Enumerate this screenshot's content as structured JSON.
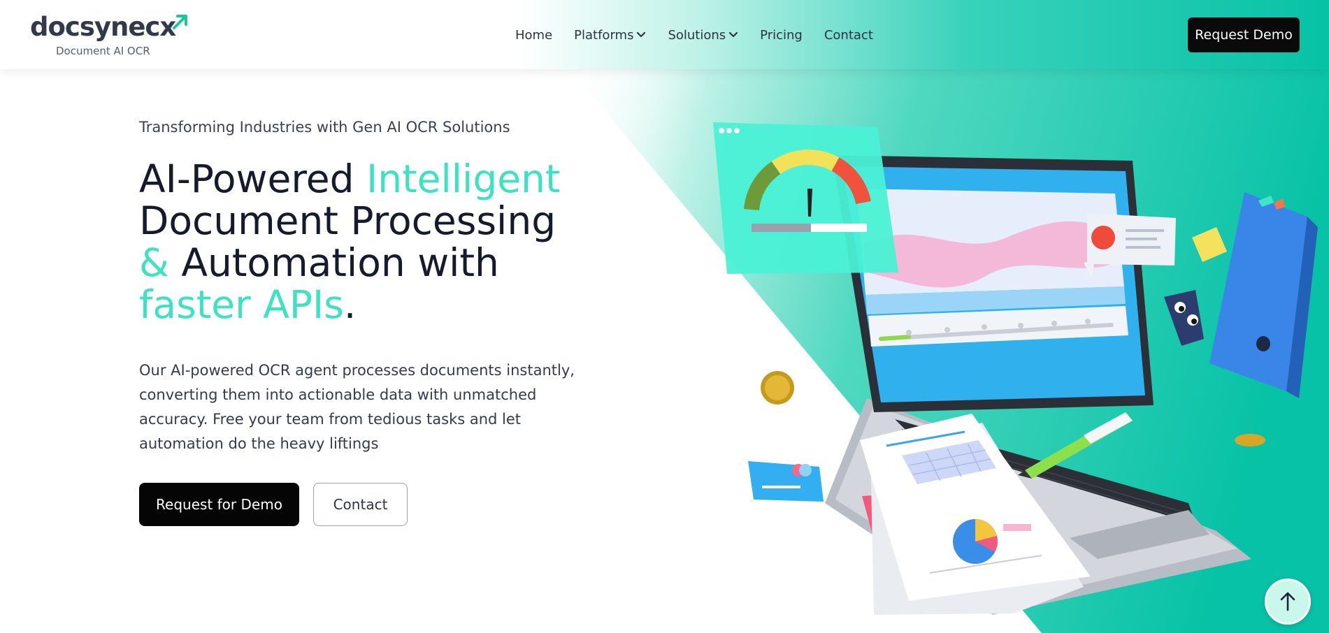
{
  "brand": {
    "name": "docsynecx",
    "subtitle": "Document AI OCR"
  },
  "nav": {
    "items": [
      {
        "label": "Home"
      },
      {
        "label": "Platforms"
      },
      {
        "label": "Solutions"
      },
      {
        "label": "Pricing"
      },
      {
        "label": "Contact"
      }
    ],
    "cta_label": "Request Demo"
  },
  "hero": {
    "tagline": "Transforming Industries with Gen AI OCR Solutions",
    "headline": {
      "part1": "AI-Powered ",
      "part2": "Intelligent",
      "part3": "Document Processing",
      "part4": "&",
      "part5": " Automation with",
      "part6": "faster APIs",
      "part7": "."
    },
    "description": "Our AI-powered OCR agent processes documents instantly, converting them into actionable data with unmatched accuracy. Free your team from tedious tasks and let automation do the heavy liftings",
    "primary_button": "Request for Demo",
    "secondary_button": "Contact"
  },
  "colors": {
    "accent": "#3ee1c2",
    "teal": "#07c2a6",
    "dark": "#0a0a0a"
  },
  "icons": {
    "scroll_top": "arrow-up-icon",
    "chevron": "chevron-down-icon"
  }
}
